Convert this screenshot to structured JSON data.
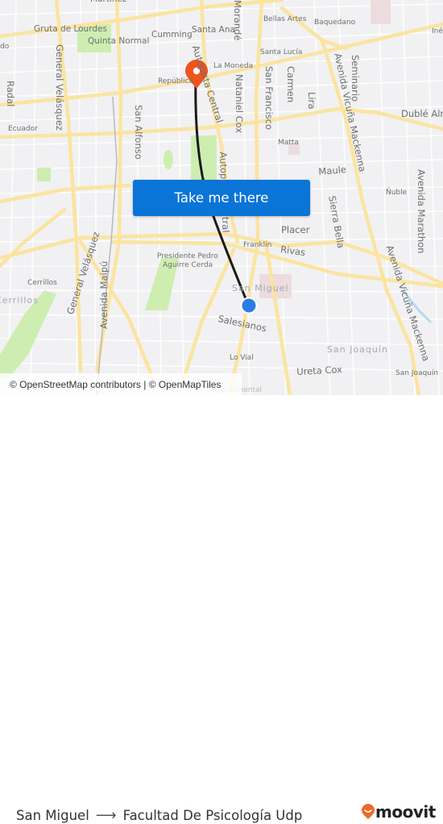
{
  "map": {
    "labels": {
      "martinez": "Martínez",
      "gruta": "Gruta de Lourdes",
      "quinta": "Quinta Normal",
      "cumming": "Cumming",
      "santa_ana": "Santa Ana",
      "bellas_artes": "Bellas Artes",
      "baquedano": "Baquedano",
      "ines": "Inés",
      "do": "do",
      "santa_lucia": "Santa Lucía",
      "la_moneda": "La Moneda",
      "republica": "República",
      "general_velasquez": "General Velásquez",
      "radal": "Radal",
      "morande": "Morandé",
      "autopista_central_n": "Autopista Central",
      "nataniel_cox": "Nataniel Cox",
      "san_francisco": "San Francisco",
      "carmen": "Carmen",
      "lira": "Lira",
      "avenida_vicuna_n": "Avenida Vicuña Mackenna",
      "seminario": "Seminario",
      "duble": "Dublé Almeyda",
      "ecuador": "Ecuador",
      "san_alfonso": "San Alfonso",
      "matta": "Matta",
      "maule": "Maule",
      "nuble": "Ñuble",
      "avenida_marathon": "Avenida Marathon",
      "autopista_central_s": "Autopista Central",
      "sierra_bella": "Sierra Bella",
      "placer": "Placer",
      "franklin": "Franklin",
      "rivas": "Rivas",
      "presidente": "Presidente Pedro",
      "aguirre": "Aguirre Cerda",
      "cerrillos": "Cerrillos",
      "cerrillos_district": "Cerrillos",
      "general_velasquez_s": "General Velásquez",
      "avenida_maipu": "Avenida Maipú",
      "san_miguel": "San Miguel",
      "salesianos": "Salesianos",
      "avenida_vicuna_s": "Avenida Vicuña Mackenna",
      "san_joaquin_district": "San Joaquín",
      "lo_vial": "Lo Vial",
      "ureta_cox": "Ureta Cox",
      "san_joaquin": "San Joaquín",
      "departamental": "Departamental"
    },
    "colors": {
      "background": "#f1f1f3",
      "road_major": "#fbe4a0",
      "park": "#cdeeb0",
      "route_line": "#1a1a1a",
      "origin_dot": "#2a7de1",
      "destination_pin": "#f0531c"
    },
    "origin_marker": "origin-location-dot",
    "destination_marker": "destination-pin-icon"
  },
  "cta": {
    "label": "Take me there",
    "color": "#0a74d7"
  },
  "attribution": {
    "text": "© OpenStreetMap contributors | © OpenMapTiles"
  },
  "route": {
    "origin": "San Miguel",
    "arrow_icon": "arrow-right-icon",
    "destination": "Facultad De Psicología Udp"
  },
  "brand": {
    "name": "moovit",
    "color": "#f0682a"
  }
}
